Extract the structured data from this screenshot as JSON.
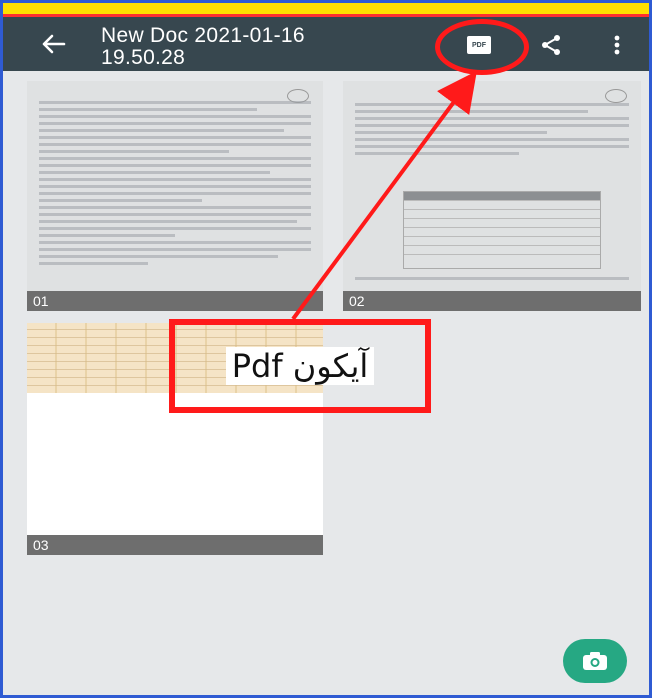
{
  "header": {
    "title": "New Doc 2021-01-16\n19.50.28",
    "title_line1": "New Doc 2021-01-16",
    "title_line2": "19.50.28",
    "actions": [
      "back-icon",
      "pdf-icon",
      "share-icon",
      "more-vert-icon"
    ],
    "pdf_icon_text": "PDF"
  },
  "pages": [
    {
      "label": "01"
    },
    {
      "label": "02"
    },
    {
      "label": "03"
    }
  ],
  "annotation": {
    "text": "آیکون Pdf",
    "color": "#ff1a1a"
  },
  "fab": {
    "icon": "camera-icon",
    "color": "#26a883"
  },
  "colors": {
    "appbar": "#37474f",
    "background": "#e6e8ea",
    "label_bar": "#6e6e6e"
  }
}
